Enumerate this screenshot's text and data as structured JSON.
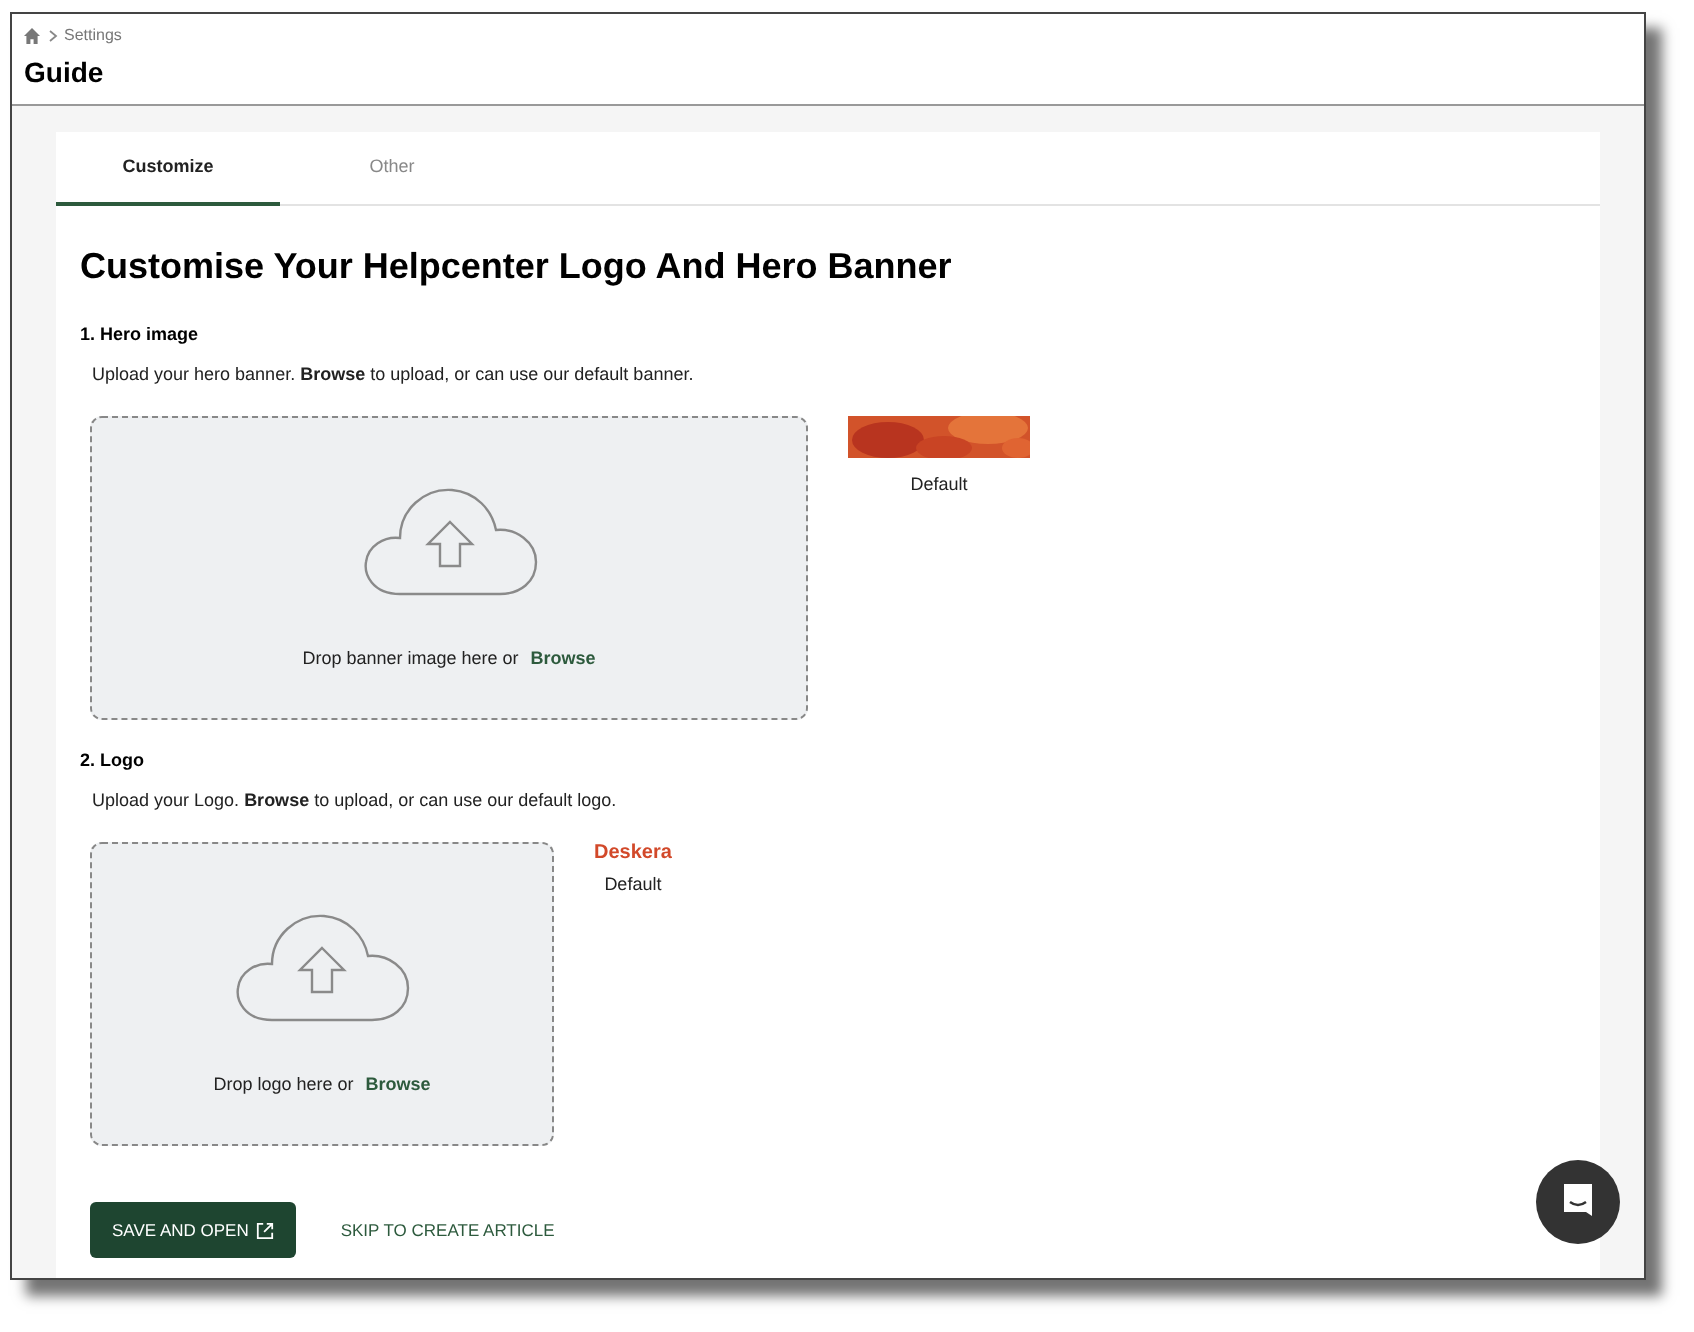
{
  "breadcrumb": {
    "items": [
      "Settings"
    ]
  },
  "page_title": "Guide",
  "tabs": [
    {
      "label": "Customize",
      "selected": true
    },
    {
      "label": "Other",
      "selected": false
    }
  ],
  "heading": "Customise Your Helpcenter Logo And Hero Banner",
  "sections": [
    {
      "kind": "banner",
      "title": "1. Hero image",
      "description": "Upload your hero banner. **Browse** to upload, or can use our default banner.",
      "drop_text": "Drop banner image here or",
      "drop_link": "Browse",
      "default_label": "Default"
    },
    {
      "kind": "logo",
      "title": "2. Logo",
      "description": "Upload your Logo. **Browse** to upload, or can use our default logo.",
      "drop_text": "Drop logo here or",
      "drop_link": "Browse",
      "default_logo": "Deskera",
      "default_label": "Default"
    }
  ],
  "actions": {
    "primary": "SAVE AND OPEN",
    "secondary": "SKIP TO CREATE ARTICLE"
  }
}
